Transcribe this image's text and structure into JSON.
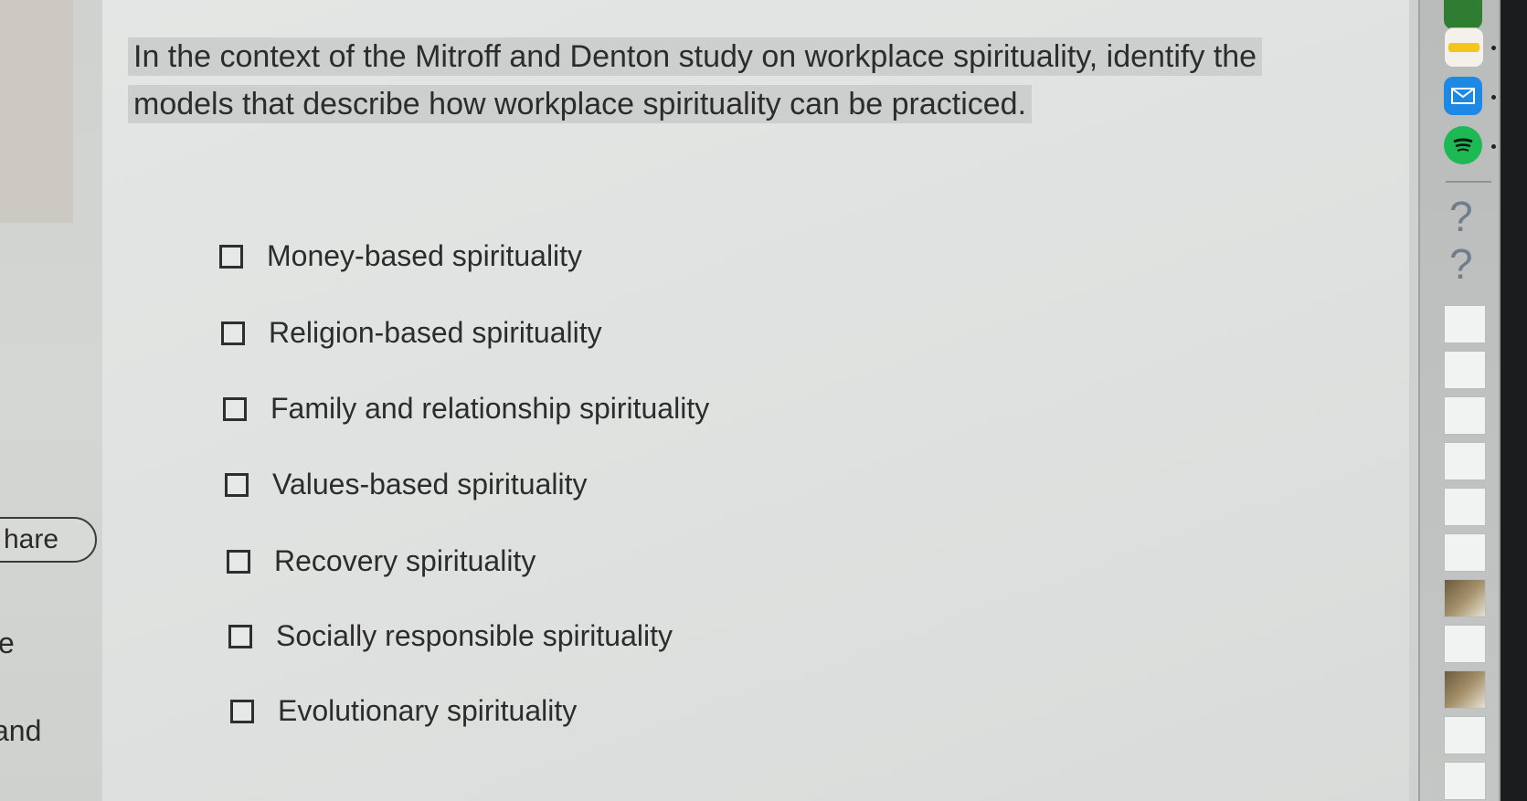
{
  "left_panel": {
    "share_label": "hare",
    "fragments": [
      "e",
      "and"
    ]
  },
  "question": {
    "text": "In the context of the Mitroff and Denton study on workplace spirituality, identify the models that describe how workplace spirituality can be practiced."
  },
  "options": [
    {
      "label": "Money-based spirituality",
      "checked": false
    },
    {
      "label": "Religion-based spirituality",
      "checked": false
    },
    {
      "label": "Family and relationship spirituality",
      "checked": false
    },
    {
      "label": "Values-based spirituality",
      "checked": false
    },
    {
      "label": "Recovery spirituality",
      "checked": false
    },
    {
      "label": "Socially responsible spirituality",
      "checked": false
    },
    {
      "label": "Evolutionary spirituality",
      "checked": false
    }
  ],
  "dock": {
    "apps": [
      {
        "name": "notes-icon",
        "color": "#f3f1ea"
      },
      {
        "name": "mail-icon",
        "color": "#1e88e5"
      },
      {
        "name": "spotify-icon",
        "color": "#1db954"
      }
    ],
    "help_marks": [
      "?",
      "?"
    ]
  }
}
